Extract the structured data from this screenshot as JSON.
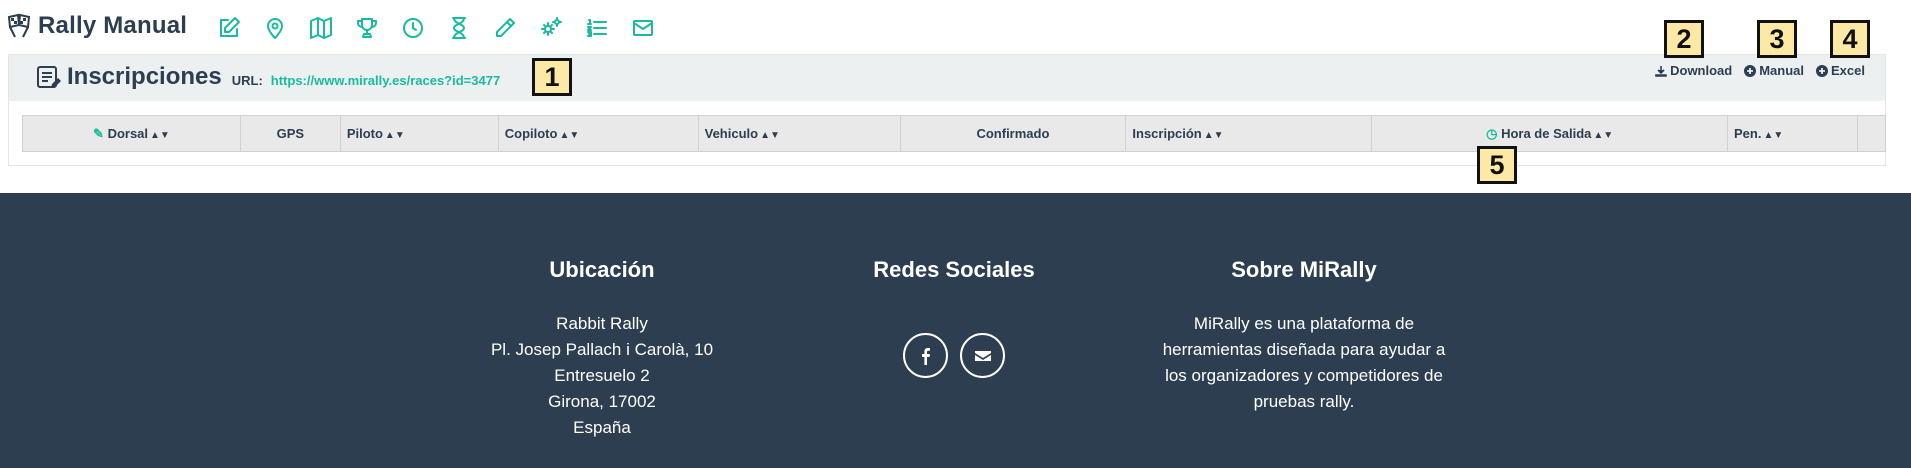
{
  "brand": {
    "title": "Rally Manual",
    "icon": "checkered-flags-icon"
  },
  "nav": [
    {
      "name": "edit-icon"
    },
    {
      "name": "map-marker-icon"
    },
    {
      "name": "map-icon"
    },
    {
      "name": "trophy-icon"
    },
    {
      "name": "clock-icon"
    },
    {
      "name": "hourglass-icon"
    },
    {
      "name": "pencil-icon"
    },
    {
      "name": "cogs-icon"
    },
    {
      "name": "ordered-list-icon"
    },
    {
      "name": "envelope-icon"
    }
  ],
  "panel": {
    "title": "Inscripciones",
    "url_label": "URL:",
    "url": "https://www.mirally.es/races?id=3477",
    "actions": {
      "download": "Download",
      "manual": "Manual",
      "excel": "Excel"
    }
  },
  "table": {
    "columns": {
      "dorsal": "Dorsal",
      "gps": "GPS",
      "piloto": "Piloto",
      "copiloto": "Copiloto",
      "vehiculo": "Vehiculo",
      "confirmado": "Confirmado",
      "inscripcion": "Inscripción",
      "hora_salida": "Hora de Salida",
      "pen": "Pen."
    }
  },
  "callouts": {
    "c1": "1",
    "c2": "2",
    "c3": "3",
    "c4": "4",
    "c5": "5"
  },
  "footer": {
    "location": {
      "title": "Ubicación",
      "lines": [
        "Rabbit Rally",
        "Pl. Josep Pallach i Carolà, 10",
        "Entresuelo 2",
        "Girona, 17002",
        "España"
      ]
    },
    "social": {
      "title": "Redes Sociales"
    },
    "about": {
      "title": "Sobre MiRally",
      "lines": [
        "MiRally es una plataforma de",
        "herramientas diseñada para ayudar a",
        "los organizadores y competidores de",
        "pruebas rally."
      ]
    }
  },
  "colors": {
    "accent": "#18bc9c",
    "dark": "#2c3e50",
    "panel_head": "#ecf0f1",
    "callout_bg": "#fde9a6"
  }
}
